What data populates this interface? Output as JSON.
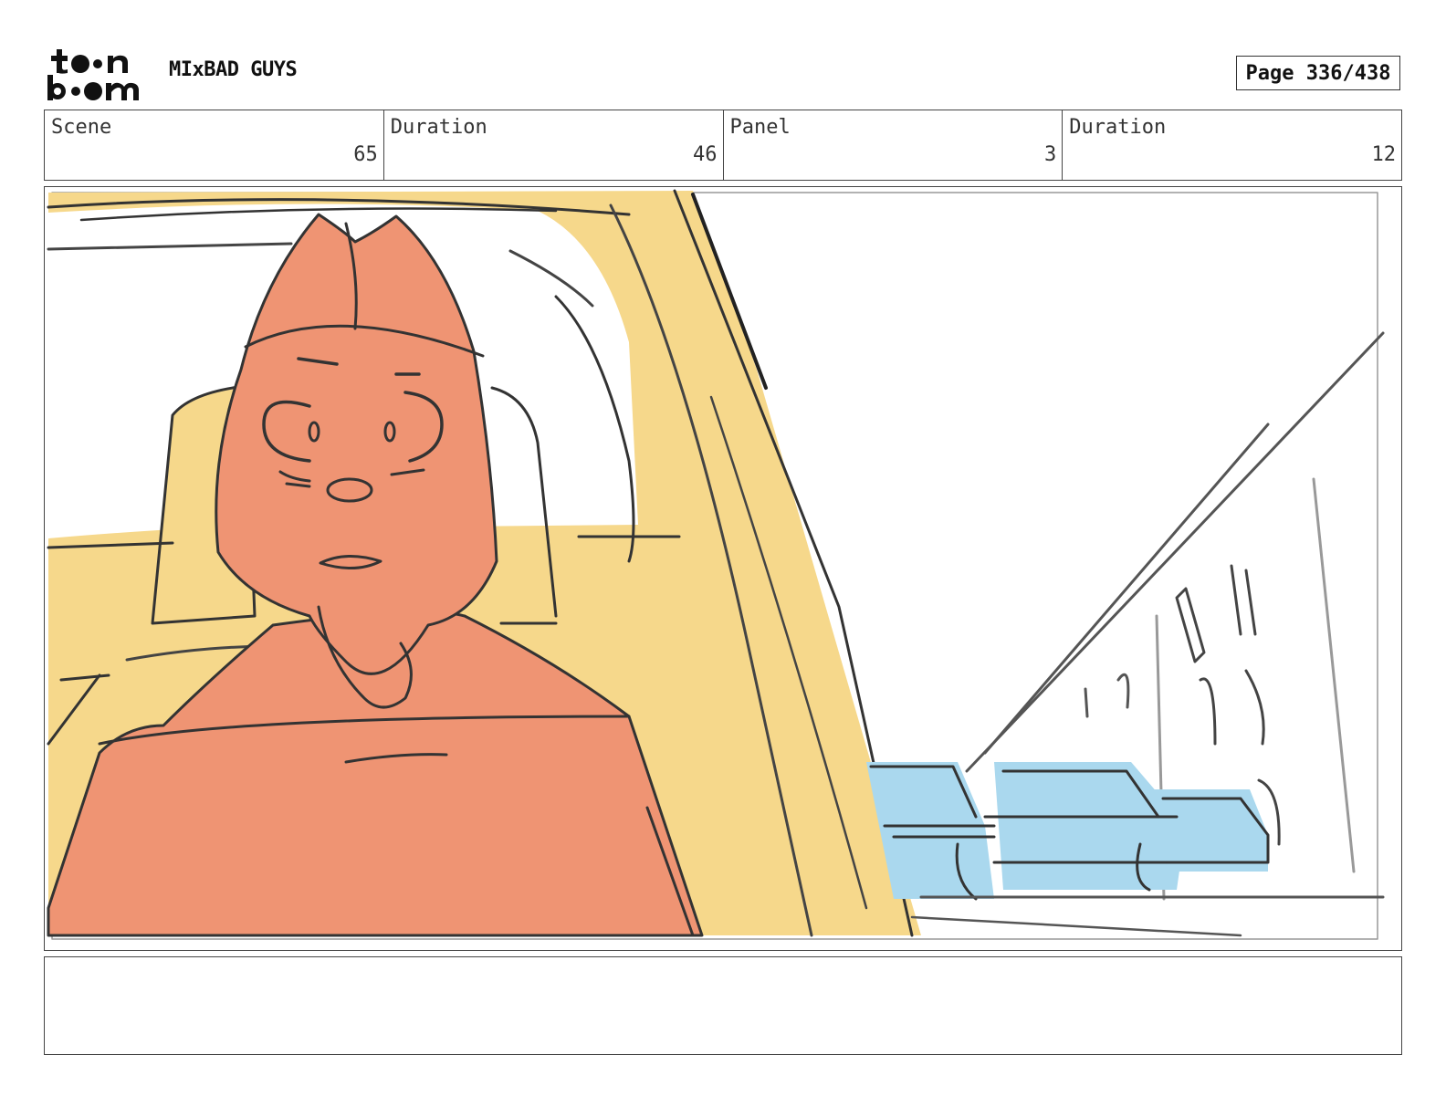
{
  "brand": {
    "logo_text_top": "toon",
    "logo_text_bottom": "boom"
  },
  "header": {
    "project_title": "MIxBAD GUYS",
    "page_label": "Page 336/438"
  },
  "info": {
    "scene_label": "Scene",
    "scene_value": "65",
    "scene_duration_label": "Duration",
    "scene_duration_value": "46",
    "panel_label": "Panel",
    "panel_value": "3",
    "panel_duration_label": "Duration",
    "panel_duration_value": "12"
  },
  "colors": {
    "character": "#ef9473",
    "car_interior": "#f6d88b",
    "cars": "#aad8ee",
    "ink": "#333333"
  },
  "notes": {
    "text": ""
  }
}
